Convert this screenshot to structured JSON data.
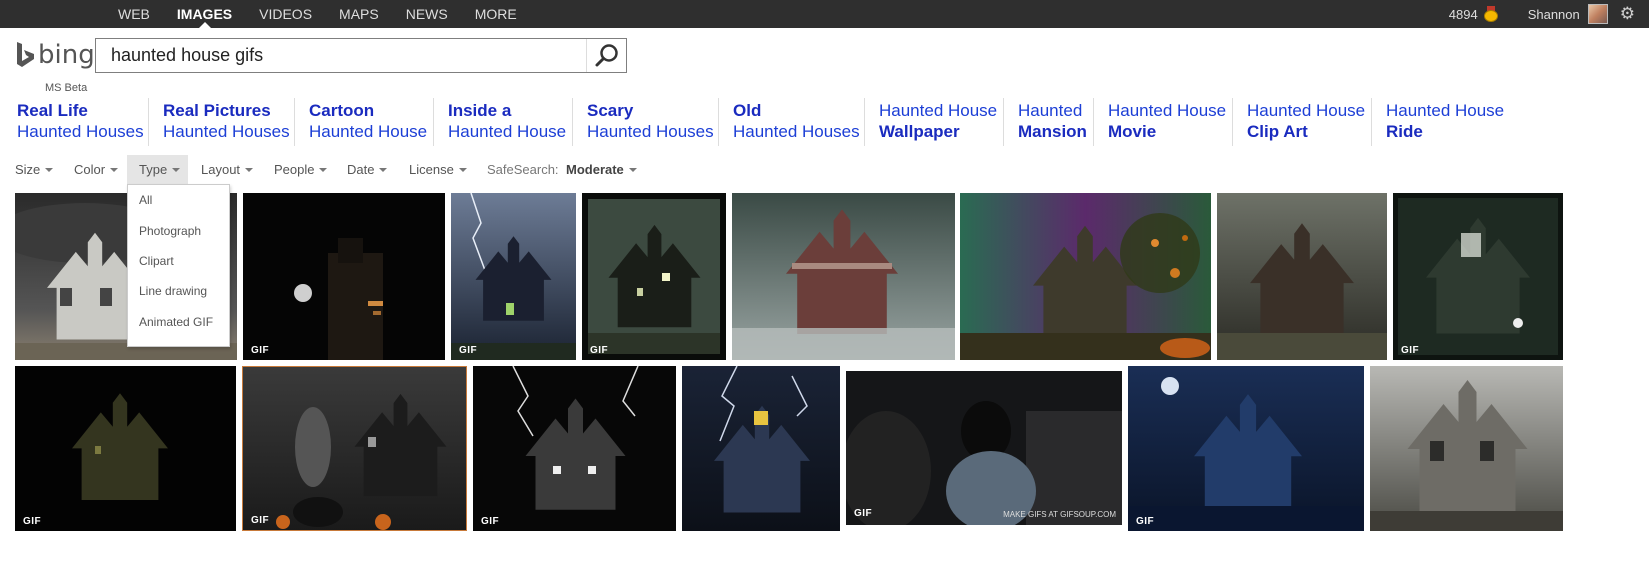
{
  "topnav": {
    "items": [
      "WEB",
      "IMAGES",
      "VIDEOS",
      "MAPS",
      "NEWS",
      "MORE"
    ],
    "active": "IMAGES"
  },
  "account": {
    "points": "4894",
    "username": "Shannon"
  },
  "brand": {
    "logo_text": "bing",
    "beta_label": "MS Beta"
  },
  "search": {
    "query": "haunted house gifs"
  },
  "related_searches": [
    {
      "line1": "Real Life",
      "line2": "Haunted Houses",
      "style": "a"
    },
    {
      "line1": "Real Pictures",
      "line2": "Haunted Houses",
      "style": "a"
    },
    {
      "line1": "Cartoon",
      "line2": "Haunted House",
      "style": "a"
    },
    {
      "line1": "Inside a",
      "line2": "Haunted House",
      "style": "a"
    },
    {
      "line1": "Scary",
      "line2": "Haunted Houses",
      "style": "a"
    },
    {
      "line1": "Old",
      "line2": "Haunted Houses",
      "style": "a"
    },
    {
      "line1": "Haunted House",
      "line2": "Wallpaper",
      "style": "b"
    },
    {
      "line1": "Haunted",
      "line2": "Mansion",
      "style": "b"
    },
    {
      "line1": "Haunted House",
      "line2": "Movie",
      "style": "b"
    },
    {
      "line1": "Haunted House",
      "line2": "Clip Art",
      "style": "b"
    },
    {
      "line1": "Haunted House",
      "line2": "Ride",
      "style": "b"
    }
  ],
  "filters": {
    "items": [
      "Size",
      "Color",
      "Type",
      "Layout",
      "People",
      "Date",
      "License"
    ],
    "open": "Type",
    "safesearch_label": "SafeSearch:",
    "safesearch_value": "Moderate"
  },
  "type_menu": [
    "All",
    "Photograph",
    "Clipart",
    "Line drawing",
    "Animated GIF"
  ],
  "results": {
    "gif_badge": "GIF",
    "watermark": "MAKE GIFS AT GIFSOUP.COM",
    "row1": [
      {
        "gif": false,
        "theme": "grey-night"
      },
      {
        "gif": true,
        "theme": "black-moon"
      },
      {
        "gif": true,
        "theme": "blue-storm"
      },
      {
        "gif": true,
        "theme": "dark-green"
      },
      {
        "gif": false,
        "theme": "foggy-red"
      },
      {
        "gif": false,
        "theme": "autumn"
      },
      {
        "gif": false,
        "theme": "dusk"
      },
      {
        "gif": true,
        "theme": "ghost-green"
      }
    ],
    "row2": [
      {
        "gif": true,
        "theme": "olive-dark"
      },
      {
        "gif": true,
        "theme": "witch"
      },
      {
        "gif": true,
        "theme": "lightning-bw"
      },
      {
        "gif": false,
        "theme": "blue-lightning"
      },
      {
        "gif": true,
        "theme": "movie",
        "watermark": true
      },
      {
        "gif": true,
        "theme": "blue-moon"
      },
      {
        "gif": false,
        "theme": "grey-mansion"
      }
    ]
  }
}
